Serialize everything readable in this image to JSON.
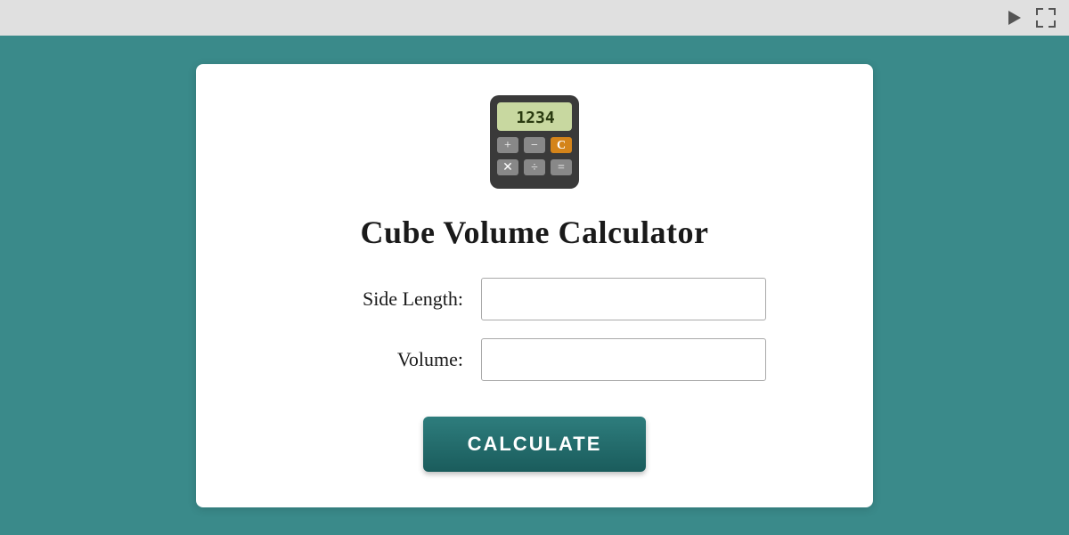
{
  "topbar": {
    "play_icon": "play-icon",
    "expand_icon": "expand-icon"
  },
  "card": {
    "title": "Cube Volume Calculator",
    "fields": [
      {
        "label": "Side Length:",
        "id": "side-length",
        "placeholder": ""
      },
      {
        "label": "Volume:",
        "id": "volume",
        "placeholder": ""
      }
    ],
    "button_label": "CALCULATE"
  }
}
